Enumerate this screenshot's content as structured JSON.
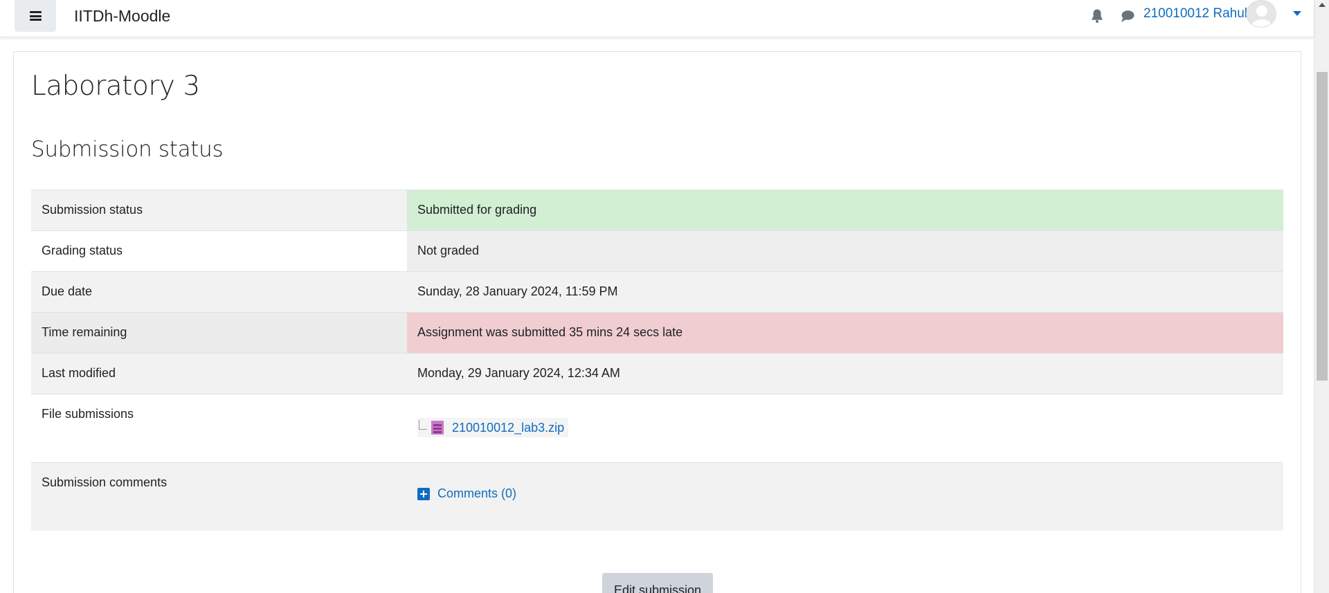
{
  "navbar": {
    "brand": "IITDh-Moodle",
    "user_name": "210010012 Rahul"
  },
  "page": {
    "title": "Laboratory 3",
    "section_title": "Submission status"
  },
  "status_table": {
    "rows": [
      {
        "label": "Submission status",
        "value": "Submitted for grading"
      },
      {
        "label": "Grading status",
        "value": "Not graded"
      },
      {
        "label": "Due date",
        "value": "Sunday, 28 January 2024, 11:59 PM"
      },
      {
        "label": "Time remaining",
        "value": "Assignment was submitted 35 mins 24 secs late"
      },
      {
        "label": "Last modified",
        "value": "Monday, 29 January 2024, 12:34 AM"
      },
      {
        "label": "File submissions",
        "value": "210010012_lab3.zip"
      },
      {
        "label": "Submission comments",
        "value": "Comments (0)"
      }
    ]
  },
  "actions": {
    "edit_submission": "Edit submission"
  },
  "colors": {
    "link": "#0f6cbf",
    "status_submitted": "#d2eed3",
    "status_late": "#f0cdd0"
  },
  "icons": [
    "menu-icon",
    "bell-icon",
    "chat-icon",
    "avatar-icon",
    "caret-down-icon",
    "zip-file-icon",
    "plus-square-icon"
  ]
}
